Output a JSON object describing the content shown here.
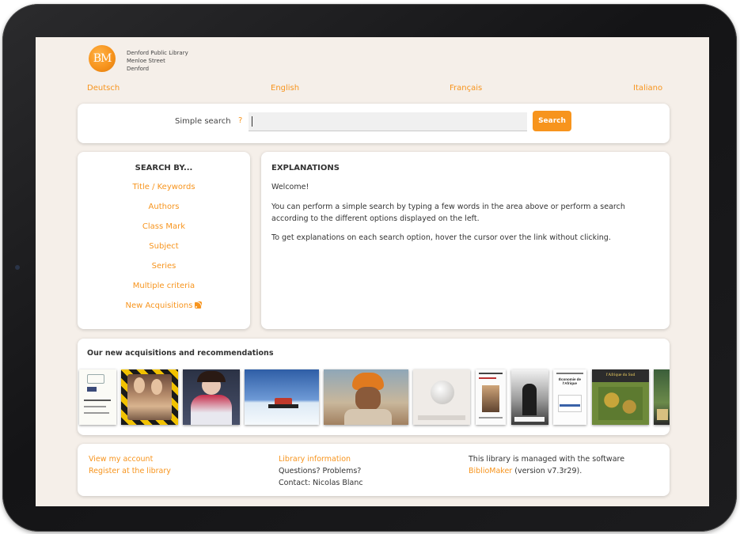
{
  "library": {
    "logo_text": "BM",
    "name": "Denford Public Library",
    "street": "Menloe Street",
    "city": "Denford"
  },
  "languages": [
    "Deutsch",
    "English",
    "Français",
    "Italiano"
  ],
  "search": {
    "label": "Simple search",
    "help": "?",
    "value": "",
    "button": "Search"
  },
  "search_by": {
    "title": "SEARCH BY...",
    "items": [
      "Title / Keywords",
      "Authors",
      "Class Mark",
      "Subject",
      "Series",
      "Multiple criteria",
      "New Acquisitions"
    ]
  },
  "explanations": {
    "title": "EXPLANATIONS",
    "welcome": "Welcome!",
    "p1": "You can perform a simple search by typing a few words in the area above or perform a search according to the different options displayed on the left.",
    "p2": "To get explanations on each search option, hover the cursor over the link without clicking."
  },
  "acquisitions": {
    "title": "Our new acquisitions and recommendations",
    "cover_texts": {
      "economie_title": "Économie de l'Afrique",
      "afrique_title": "l'Afrique du Sud"
    }
  },
  "footer": {
    "view_account": "View my account",
    "register": "Register at the library",
    "library_info": "Library information",
    "questions": "Questions? Problems?",
    "contact": "Contact: Nicolas Blanc",
    "managed_text": "This library is managed with the software",
    "software": "BiblioMaker",
    "version": "(version v7.3r29)."
  },
  "colors": {
    "accent": "#f7941d",
    "background": "#f5efe9",
    "card": "#ffffff",
    "text": "#333333"
  },
  "icons": {
    "rss": "rss-icon",
    "logo": "library-logo"
  }
}
